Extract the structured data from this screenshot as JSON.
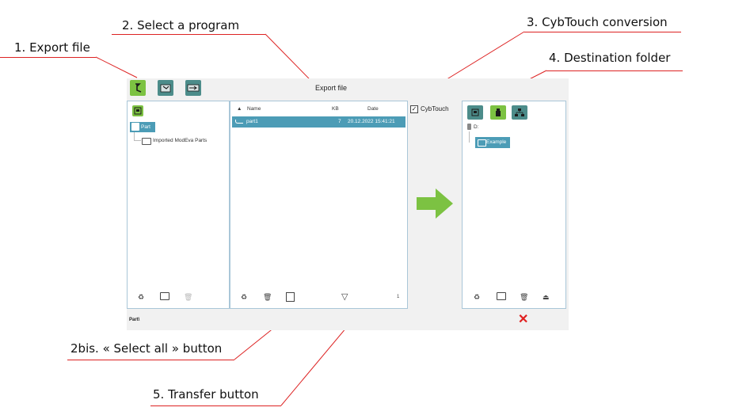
{
  "callouts": {
    "export_file": "1. Export file",
    "select_program": "2. Select a program",
    "cybtouch_conversion": "3. CybTouch conversion",
    "destination_folder": "4. Destination folder",
    "select_all": "2bis. « Select all » button",
    "transfer": "5. Transfer button"
  },
  "window": {
    "title": "Export file",
    "status_path": "Part\\"
  },
  "toolbar": {
    "buttons": [
      "export-file-icon",
      "import-file-icon",
      "machine-transfer-icon"
    ]
  },
  "left_panel": {
    "root_label": "Part",
    "child_folder": "Imported ModEva Parts"
  },
  "file_list": {
    "columns": {
      "name": "Name",
      "kb": "KB",
      "date": "Date"
    },
    "rows": [
      {
        "name": "part1",
        "kb": "7",
        "date": "20.12.2022 15:41:21"
      }
    ],
    "count": "1"
  },
  "cybtouch": {
    "label": "CybTouch",
    "checked": true
  },
  "destination": {
    "drive": "D:",
    "folder": "Example"
  },
  "colors": {
    "accent_green": "#7cc242",
    "teal": "#4c8c8a",
    "selection": "#4c9cb6",
    "close_red": "#e02020",
    "callout_line": "#dd2222"
  }
}
